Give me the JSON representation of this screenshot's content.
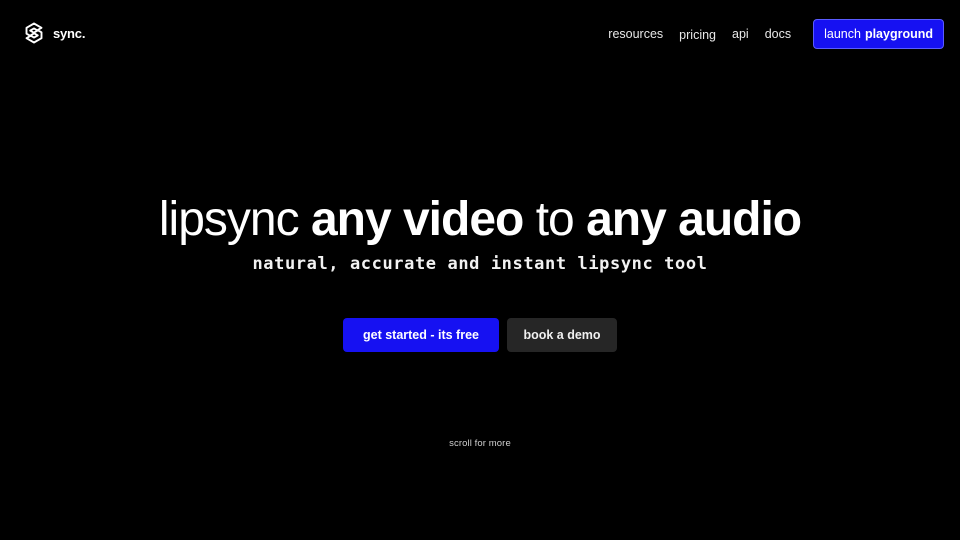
{
  "header": {
    "brand": "sync.",
    "logo_icon": "sync-logo-icon",
    "nav": {
      "resources": "resources",
      "pricing": "pricing",
      "api": "api",
      "docs": "docs"
    },
    "launch": {
      "prefix": "launch",
      "strong": "playground"
    }
  },
  "hero": {
    "headline": {
      "part1": "lipsync",
      "part2": "any video",
      "part3": "to",
      "part4": "any audio"
    },
    "subtitle": "natural, accurate and instant lipsync tool"
  },
  "cta": {
    "primary": "get started - its free",
    "secondary": "book a demo"
  },
  "scroll_hint": "scroll for more",
  "colors": {
    "background": "#000000",
    "accent": "#1611f2",
    "secondary_button": "#262626",
    "text": "#ffffff"
  }
}
